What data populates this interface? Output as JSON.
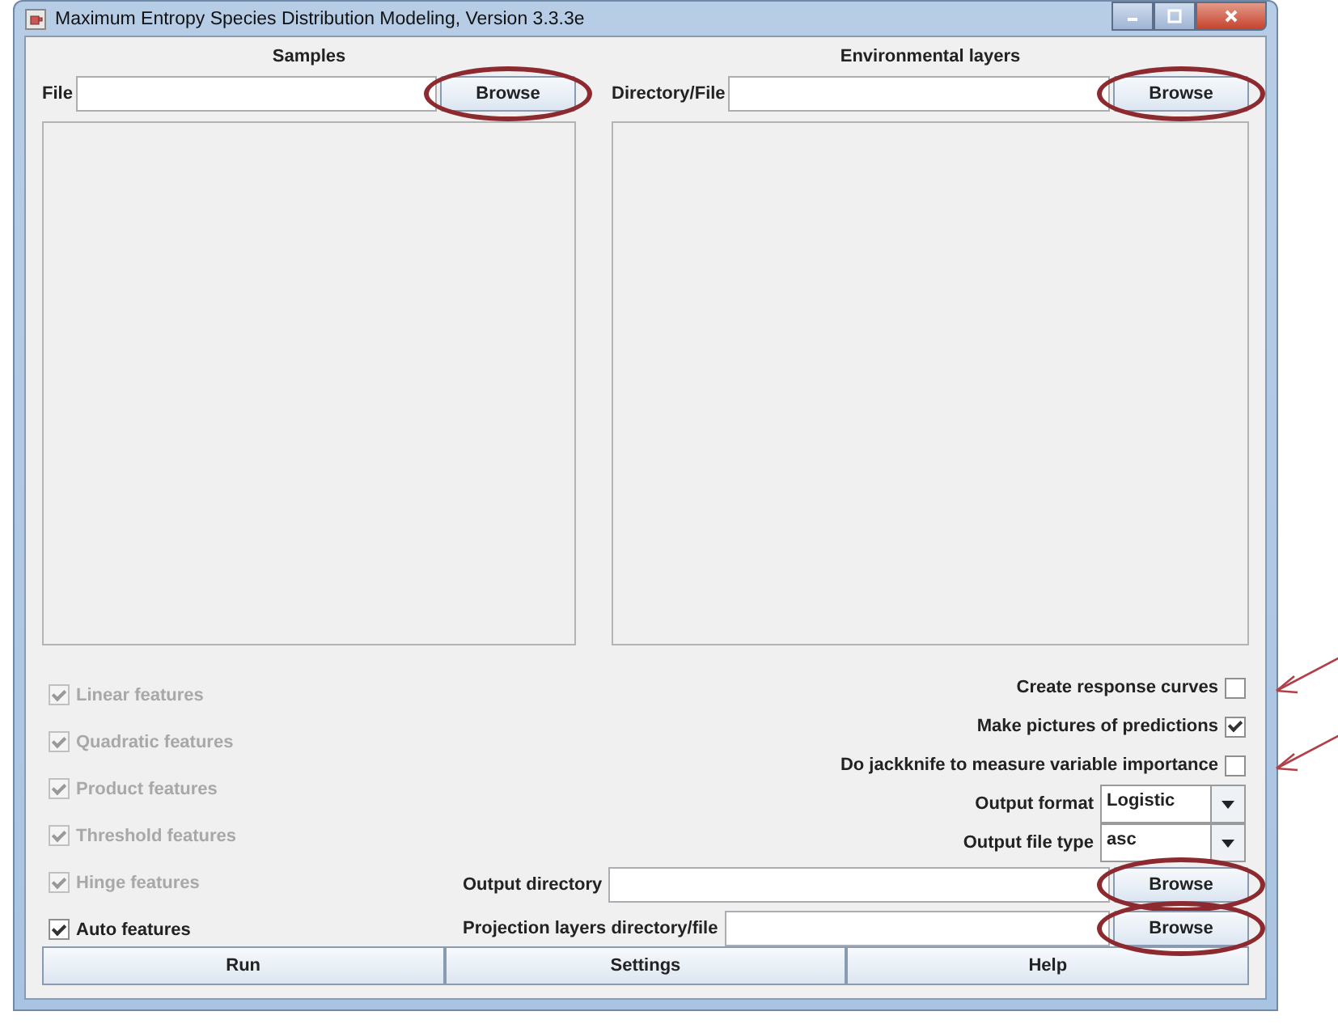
{
  "window": {
    "title": "Maximum Entropy Species Distribution Modeling, Version 3.3.3e"
  },
  "samples": {
    "heading": "Samples",
    "label": "File",
    "browse": {
      "label": "Browse",
      "highlighted": true
    }
  },
  "environmental_layers": {
    "heading": "Environmental layers",
    "label": "Directory/File",
    "browse": {
      "label": "Browse",
      "highlighted": true
    }
  },
  "features": [
    {
      "label": "Linear features",
      "checked": true,
      "disabled": true
    },
    {
      "label": "Quadratic features",
      "checked": true,
      "disabled": true
    },
    {
      "label": "Product features",
      "checked": true,
      "disabled": true
    },
    {
      "label": "Threshold features",
      "checked": true,
      "disabled": true
    },
    {
      "label": "Hinge features",
      "checked": true,
      "disabled": true
    },
    {
      "label": "Auto features",
      "checked": true,
      "disabled": false
    }
  ],
  "options": [
    {
      "kind": "checkbox",
      "label": "Create response curves",
      "checked": false,
      "pointed_at": true
    },
    {
      "kind": "checkbox",
      "label": "Make pictures of predictions",
      "checked": true,
      "pointed_at": false
    },
    {
      "kind": "checkbox",
      "label": "Do jackknife to measure variable importance",
      "checked": false,
      "pointed_at": true
    },
    {
      "kind": "dropdown",
      "label": "Output format",
      "value": "Logistic"
    },
    {
      "kind": "dropdown",
      "label": "Output file type",
      "value": "asc"
    }
  ],
  "directories": [
    {
      "label": "Output directory",
      "browse": {
        "label": "Browse",
        "highlighted": true
      }
    },
    {
      "label": "Projection layers directory/file",
      "browse": {
        "label": "Browse",
        "highlighted": true
      }
    }
  ],
  "buttons": [
    "Run",
    "Settings",
    "Help"
  ]
}
